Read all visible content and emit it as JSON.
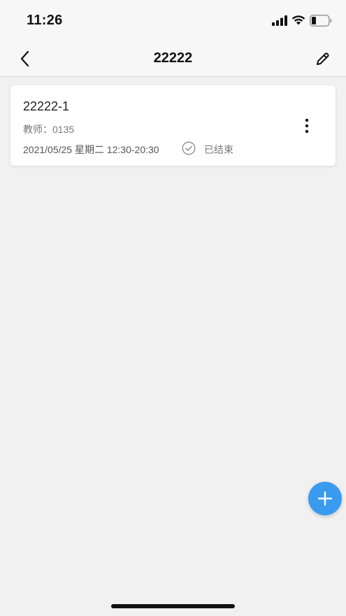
{
  "status_bar": {
    "time": "11:26"
  },
  "nav": {
    "title": "22222",
    "back_icon": "chevron-left-icon",
    "edit_icon": "pencil-icon"
  },
  "lessons": [
    {
      "title": "22222-1",
      "teacher": "教师：0135",
      "schedule": "2021/05/25 星期二 12:30-20:30",
      "status": "已结束",
      "status_icon": "check-circle-icon",
      "menu_icon": "more-vertical-icon"
    }
  ],
  "fab": {
    "icon": "plus-icon",
    "color": "#3a9af0"
  },
  "colors": {
    "background": "#f1f1f1",
    "card": "#ffffff",
    "accent": "#3a9af0"
  }
}
